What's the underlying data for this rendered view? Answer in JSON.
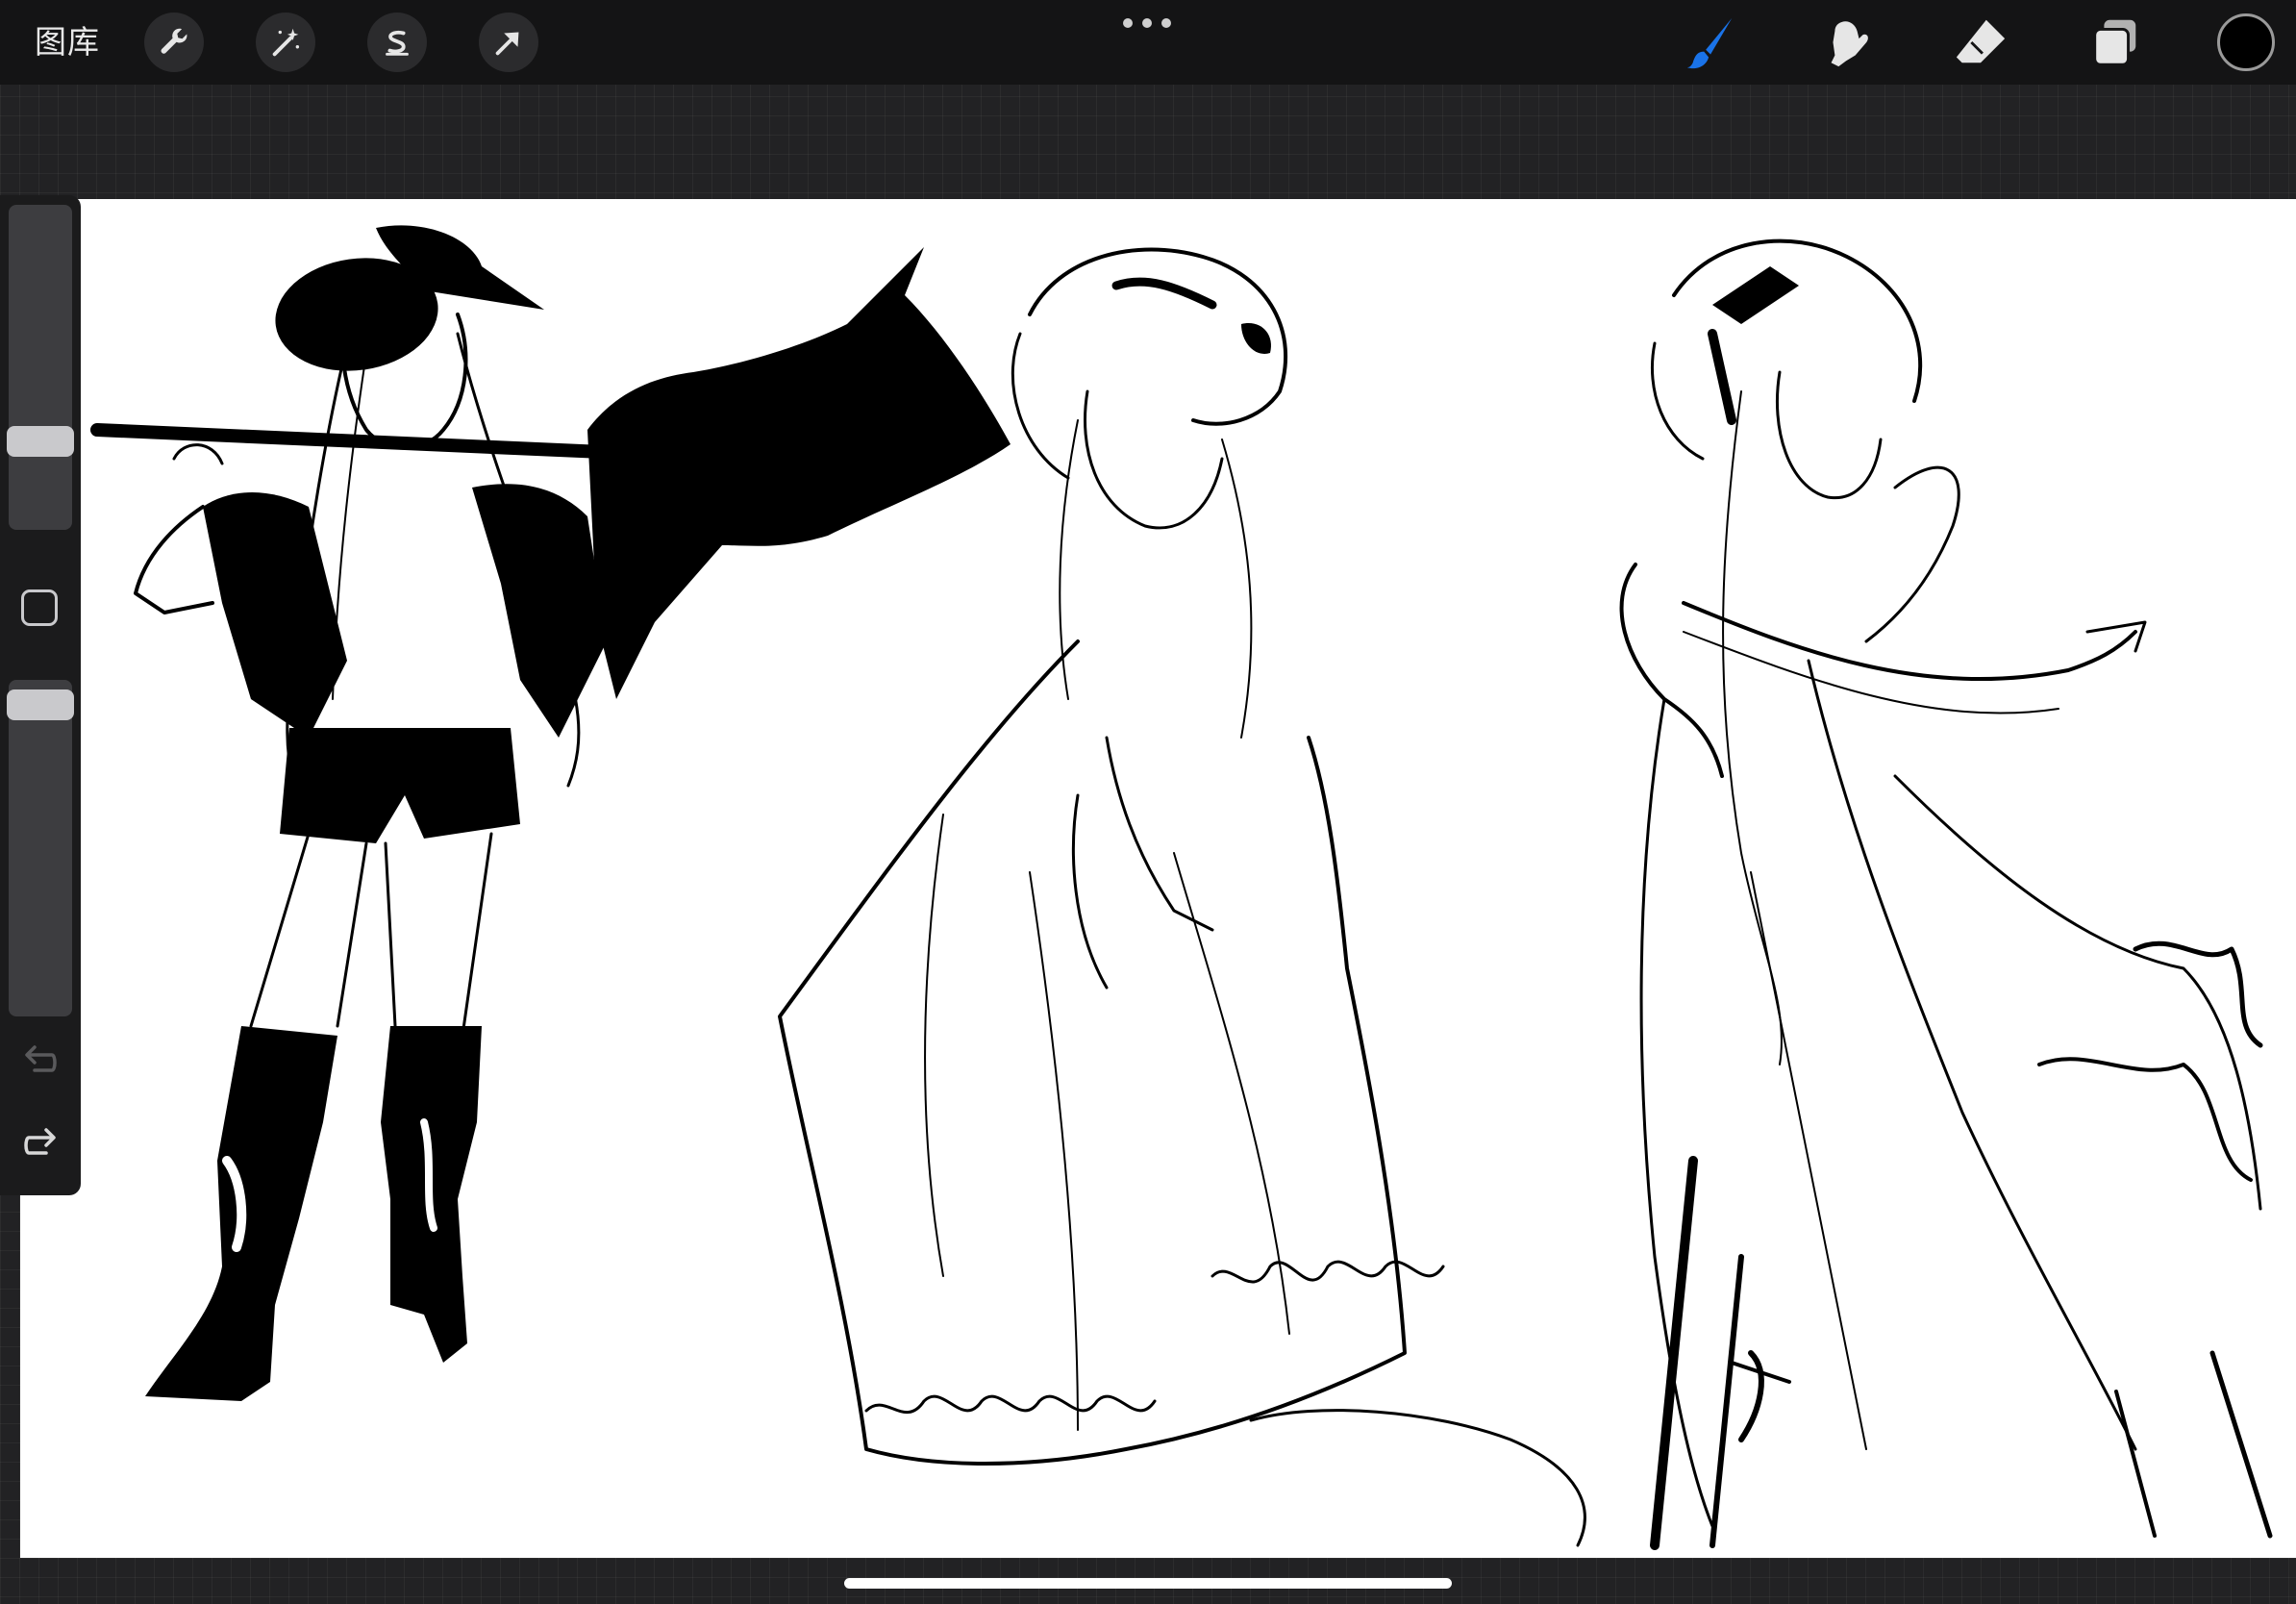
{
  "toolbar": {
    "gallery_label": "图库",
    "left_tools": [
      {
        "name": "actions",
        "icon": "wrench-icon"
      },
      {
        "name": "adjustments",
        "icon": "magic-wand-icon"
      },
      {
        "name": "selection",
        "icon": "selection-s-icon"
      },
      {
        "name": "transform",
        "icon": "arrow-cursor-icon"
      }
    ],
    "more_icon": "more-dots-icon",
    "right_tools": [
      {
        "name": "brush",
        "icon": "brush-icon",
        "active": true
      },
      {
        "name": "smudge",
        "icon": "smudge-icon",
        "active": false
      },
      {
        "name": "eraser",
        "icon": "eraser-icon",
        "active": false
      },
      {
        "name": "layers",
        "icon": "layers-icon",
        "active": false
      }
    ],
    "current_color": "#000000",
    "active_color": "#1a73e8"
  },
  "sidebar": {
    "brush_size_fraction": 0.25,
    "opacity_fraction": 0.97,
    "modify_icon": "square-modify-icon",
    "undo_icon": "undo-icon",
    "redo_icon": "redo-icon"
  }
}
